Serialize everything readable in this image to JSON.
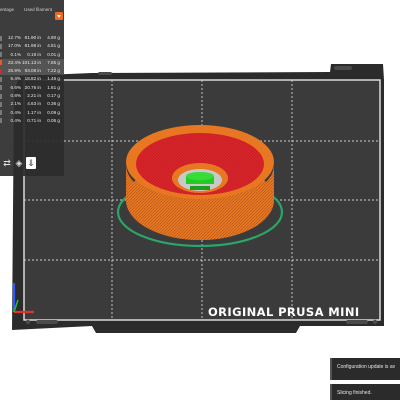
{
  "legend": {
    "col_percentage": "entage",
    "col_used_filament": "Used filament",
    "rows": [
      {
        "percent": "12.7%",
        "length": "61.90 in",
        "weight": "4.80 g",
        "color": "#7a7a7a",
        "selected": false
      },
      {
        "percent": "17.0%",
        "length": "61.98 in",
        "weight": "4.81 g",
        "color": "#7a7a7a",
        "selected": false
      },
      {
        "percent": "0.1%",
        "length": "0.19 in",
        "weight": "0.01 g",
        "color": "#7a7a7a",
        "selected": false
      },
      {
        "percent": "23.4%",
        "length": "101.13 in",
        "weight": "7.85 g",
        "color": "#e65a28",
        "selected": true
      },
      {
        "percent": "25.9%",
        "length": "93.08 in",
        "weight": "7.22 g",
        "color": "#d9252a",
        "selected": true
      },
      {
        "percent": "5.4%",
        "length": "18.82 in",
        "weight": "1.46 g",
        "color": "#7a7a7a",
        "selected": false
      },
      {
        "percent": "6.6%",
        "length": "20.76 in",
        "weight": "1.61 g",
        "color": "#7a7a7a",
        "selected": false
      },
      {
        "percent": "0.8%",
        "length": "2.21 in",
        "weight": "0.17 g",
        "color": "#7a7a7a",
        "selected": false
      },
      {
        "percent": "2.1%",
        "length": "4.63 in",
        "weight": "0.36 g",
        "color": "#7a7a7a",
        "selected": false
      },
      {
        "percent": "0.4%",
        "length": "1.17 in",
        "weight": "0.09 g",
        "color": "#7a7a7a",
        "selected": false
      },
      {
        "percent": "0.4%",
        "length": "0.71 in",
        "weight": "0.05 g",
        "color": "#7a7a7a",
        "selected": false
      }
    ],
    "tool_icons": [
      "show-hide-icon",
      "cube-icon",
      "export-icon"
    ]
  },
  "bed": {
    "label": "ORIGINAL PRUSA MINI",
    "frame_color": "#2b2b2b",
    "plate_color": "#3a3a3a",
    "grid_color": "#d9d9d9"
  },
  "model": {
    "perimeter_color": "#e87722",
    "infill_color": "#d9252a",
    "top_color": "#c81e1e",
    "skirt_color": "#2aa66b",
    "core_color": "#22cc22"
  },
  "notifications": [
    {
      "text": "Configuration update is av"
    },
    {
      "text": "Slicing finished."
    }
  ]
}
